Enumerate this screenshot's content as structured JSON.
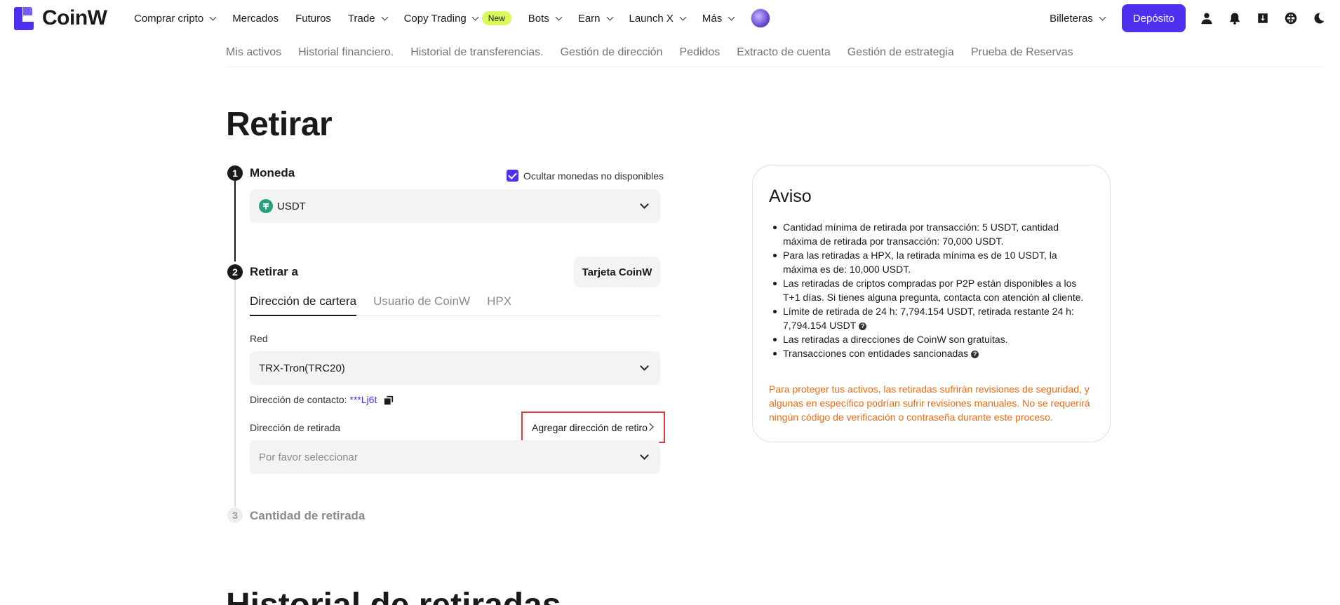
{
  "brand": {
    "name": "CoinW"
  },
  "nav": {
    "items": [
      {
        "label": "Comprar cripto",
        "dropdown": true
      },
      {
        "label": "Mercados",
        "dropdown": false
      },
      {
        "label": "Futuros",
        "dropdown": false
      },
      {
        "label": "Trade",
        "dropdown": true
      },
      {
        "label": "Copy Trading",
        "dropdown": true,
        "badge": "New"
      },
      {
        "label": "Bots",
        "dropdown": true
      },
      {
        "label": "Earn",
        "dropdown": true
      },
      {
        "label": "Launch X",
        "dropdown": true
      },
      {
        "label": "Más",
        "dropdown": true
      }
    ],
    "wallets_label": "Billeteras",
    "deposit_label": "Depósito",
    "icons": [
      "user-icon",
      "bell-icon",
      "download-icon",
      "globe-icon",
      "moon-icon"
    ]
  },
  "subtabs": [
    "Mis activos",
    "Historial financiero.",
    "Historial de transferencias.",
    "Gestión de dirección",
    "Pedidos",
    "Extracto de cuenta",
    "Gestión de estrategia",
    "Prueba de Reservas"
  ],
  "page": {
    "title": "Retirar"
  },
  "steps": {
    "step1": {
      "number": "1",
      "label": "Moneda"
    },
    "step2": {
      "number": "2",
      "label": "Retirar a"
    },
    "step3": {
      "number": "3",
      "label": "Cantidad de retirada"
    }
  },
  "currency": {
    "hide_unavailable_label": "Ocultar monedas no disponibles",
    "hide_unavailable_checked": true,
    "selected": "USDT",
    "coin_color": "#26a17b"
  },
  "withdraw_to": {
    "card_button": "Tarjeta CoinW",
    "tabs": [
      "Dirección de cartera",
      "Usuario de CoinW",
      "HPX"
    ],
    "active_tab": "Dirección de cartera",
    "network_label": "Red",
    "network_value": "TRX-Tron(TRC20)",
    "contact_label": "Dirección de contacto:",
    "contact_value": "***Lj6t",
    "address_label": "Dirección de retirada",
    "add_address_label": "Agregar dirección de retiro",
    "address_placeholder": "Por favor seleccionar"
  },
  "notice": {
    "title": "Aviso",
    "items": [
      "Cantidad mínima de retirada por transacción: 5 USDT, cantidad máxima de retirada por transacción: 70,000 USDT.",
      "Para las retiradas a HPX, la retirada mínima es de 10 USDT, la máxima es de: 10,000 USDT.",
      "Las retiradas de criptos compradas por P2P están disponibles a los T+1 días. Si tienes alguna pregunta, contacta con atención al cliente.",
      "Límite de retirada de 24 h: 7,794.154 USDT, retirada restante 24 h: 7,794.154 USDT",
      "Las retiradas a direcciones de CoinW son gratuitas.",
      "Transacciones con entidades sancionadas"
    ],
    "warning": "Para proteger tus activos, las retiradas sufrirán revisiones de seguridad, y algunas en específico podrían sufrir revisiones manuales. No se requerirá ningún código de verificación o contraseña durante este proceso."
  },
  "history": {
    "title": "Historial de retiradas"
  },
  "colors": {
    "accent": "#4f2ff0",
    "warning": "#f06a14",
    "badge": "#d8f85b",
    "highlight_border": "#e03a3a"
  }
}
